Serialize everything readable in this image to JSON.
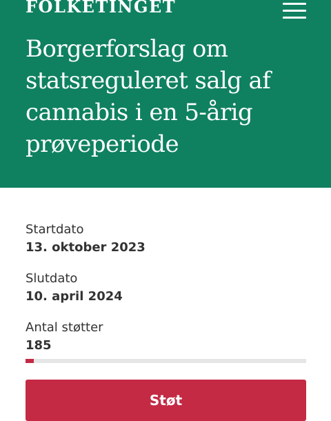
{
  "header": {
    "logo_text": "FOLKETINGET",
    "menu_icon": "hamburger-menu-icon",
    "title": "Borgerforslag om statsreguleret salg af cannabis i en 5-årig prøveperiode",
    "background_color": "#0f8160"
  },
  "details": {
    "start": {
      "label": "Startdato",
      "value": "13. oktober 2023"
    },
    "end": {
      "label": "Slutdato",
      "value": "10. april 2024"
    },
    "supporters": {
      "label": "Antal støtter",
      "value": "185"
    }
  },
  "progress": {
    "fraction": 0.03,
    "fill_color": "#c42a44",
    "track_color": "#e6e6e6"
  },
  "actions": {
    "support_label": "Støt",
    "button_color": "#c42a44"
  }
}
